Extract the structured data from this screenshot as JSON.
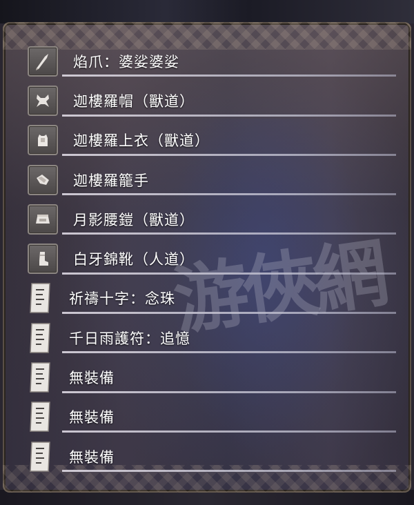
{
  "equipment": {
    "items": [
      {
        "label": "焰爪：婆娑婆娑",
        "icon": "claw-weapon-icon",
        "slot": "weapon"
      },
      {
        "label": "迦樓羅帽（獸道）",
        "icon": "helmet-icon",
        "slot": "head"
      },
      {
        "label": "迦樓羅上衣（獸道）",
        "icon": "chest-armor-icon",
        "slot": "body"
      },
      {
        "label": "迦樓羅籠手",
        "icon": "gauntlet-icon",
        "slot": "hands"
      },
      {
        "label": "月影腰鎧（獸道）",
        "icon": "waist-armor-icon",
        "slot": "waist"
      },
      {
        "label": "白牙錦靴（人道）",
        "icon": "boots-icon",
        "slot": "legs"
      },
      {
        "label": "祈禱十字：念珠",
        "icon": "charm-scroll-icon",
        "slot": "charm"
      },
      {
        "label": "千日雨護符：追憶",
        "icon": "charm-scroll-icon",
        "slot": "charm"
      },
      {
        "label": "無裝備",
        "icon": "charm-scroll-icon",
        "slot": "charm"
      },
      {
        "label": "無裝備",
        "icon": "charm-scroll-icon",
        "slot": "charm"
      },
      {
        "label": "無裝備",
        "icon": "charm-scroll-icon",
        "slot": "charm"
      }
    ]
  },
  "watermark": "游俠網",
  "colors": {
    "label_text": "#ffffff",
    "divider": "#e6e1eb",
    "icon_bg": "#5c5858"
  }
}
